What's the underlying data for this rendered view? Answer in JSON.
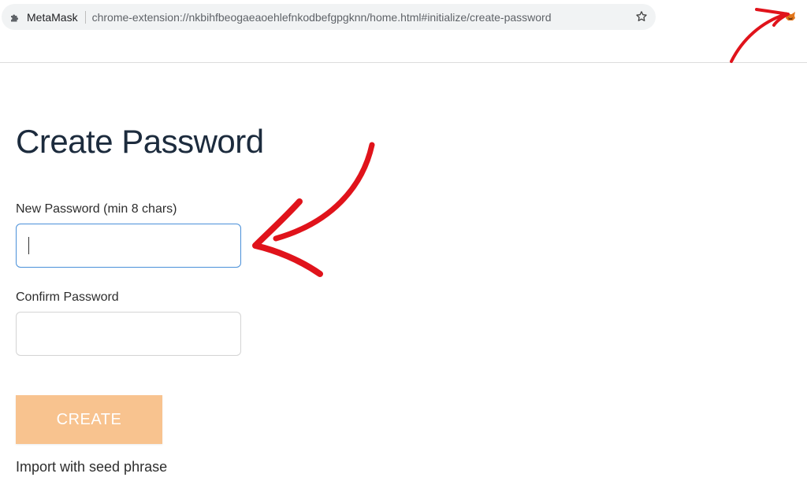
{
  "browser": {
    "site_name": "MetaMask",
    "url": "chrome-extension://nkbihfbeogaeaoehlefnkodbefgpgknn/home.html#initialize/create-password",
    "icons": {
      "extension": "puzzle-piece-icon",
      "bookmark": "star-icon",
      "toolbar_extension": "metamask-fox-icon"
    }
  },
  "page": {
    "title": "Create Password",
    "new_password": {
      "label": "New Password (min 8 chars)",
      "value": "",
      "focused": true
    },
    "confirm_password": {
      "label": "Confirm Password",
      "value": ""
    },
    "create_button": "CREATE",
    "import_link": "Import with seed phrase"
  },
  "colors": {
    "title": "#1c2b3d",
    "button_bg": "#f8c38f",
    "focus_border": "#4a90d9",
    "annotation": "#e0131b"
  }
}
